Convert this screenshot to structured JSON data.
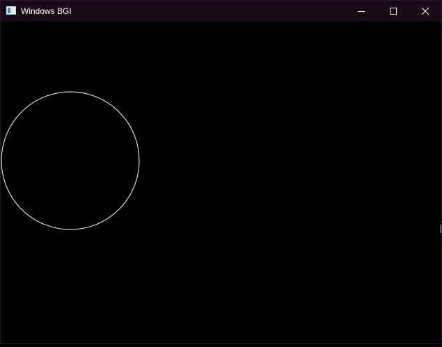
{
  "window": {
    "title": "Windows BGI",
    "icon": "app-window-icon",
    "controls": {
      "minimize_icon": "minimize-icon",
      "maximize_icon": "maximize-icon",
      "close_icon": "close-icon"
    }
  },
  "canvas": {
    "background_color": "#000000",
    "shapes": [
      {
        "type": "circle",
        "stroke_color": "#ffffff"
      }
    ]
  },
  "colors": {
    "titlebar": "#170b15",
    "title_text": "#ffffff",
    "drawing_stroke": "#ffffff"
  }
}
